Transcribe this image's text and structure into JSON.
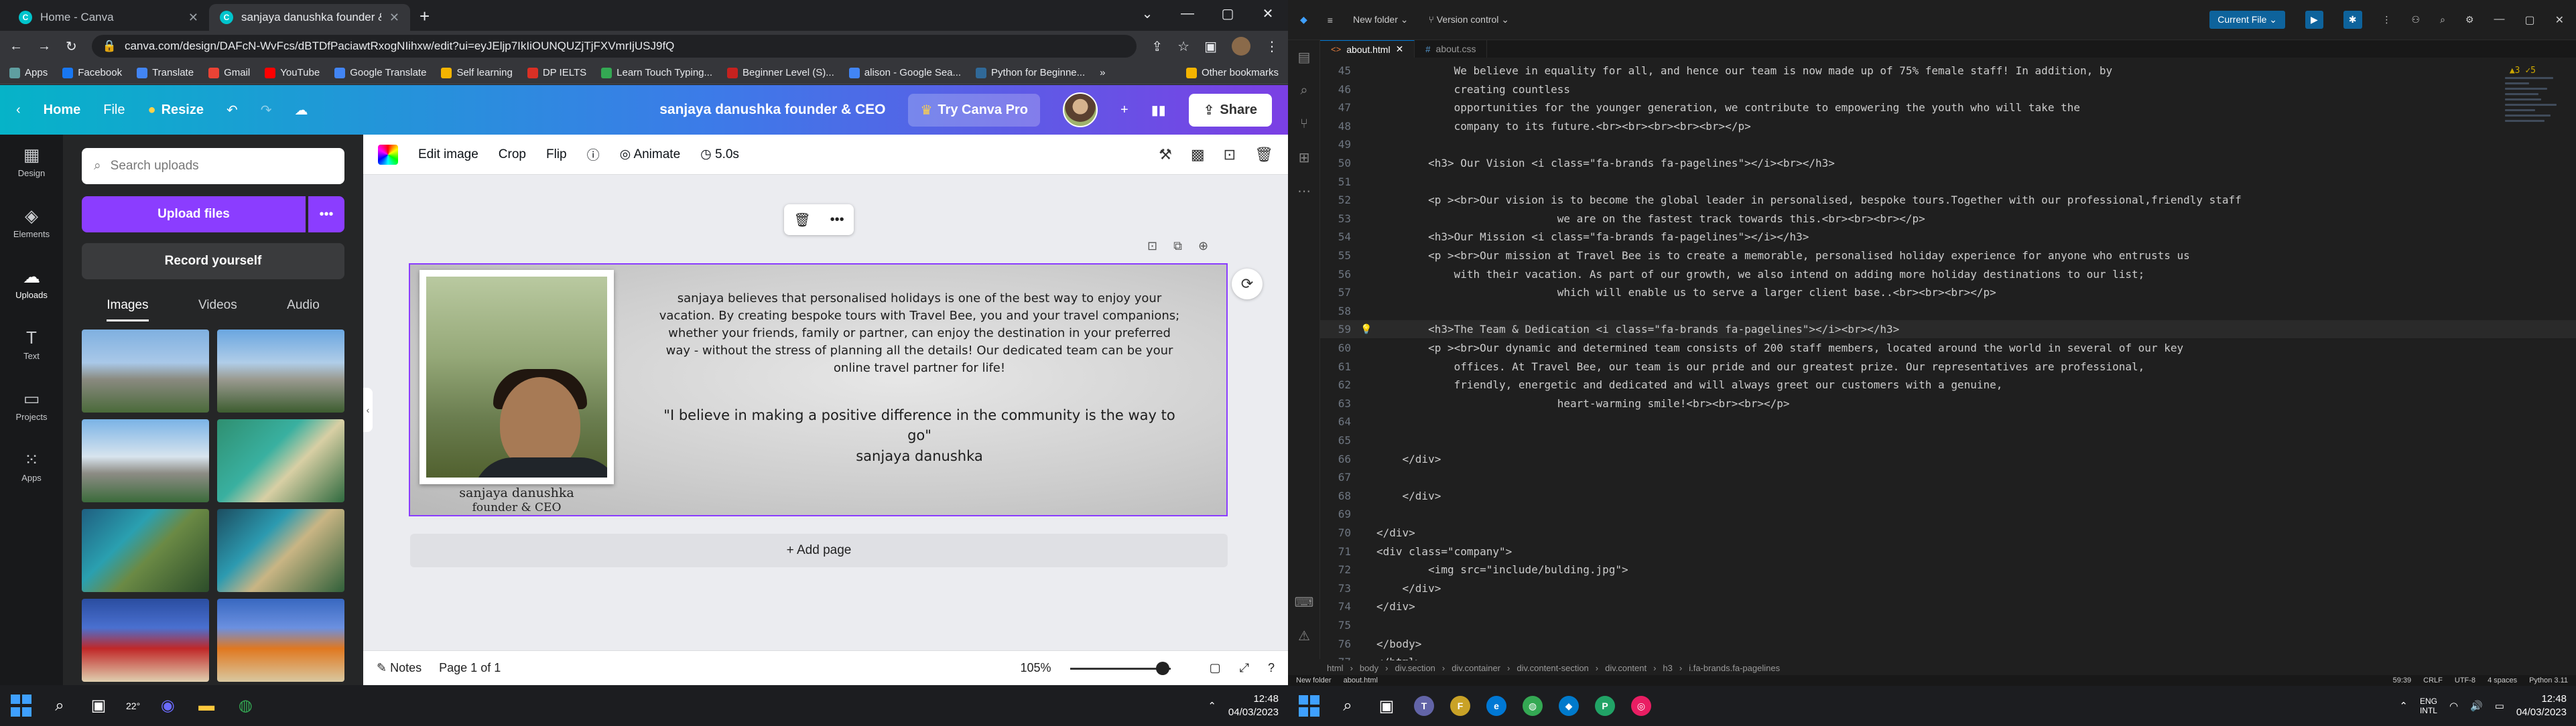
{
  "chrome": {
    "tabs": [
      {
        "title": "Home - Canva",
        "active": false
      },
      {
        "title": "sanjaya danushka founder & CEO",
        "active": true
      }
    ],
    "url": "canva.com/design/DAFcN-WvFcs/dBTDfPaciawtRxogNIihxw/edit?ui=eyJEljp7IkIiOUNQUZjTjFXVmrIjUSJ9fQ",
    "bookmarks": [
      "Apps",
      "Facebook",
      "Translate",
      "Gmail",
      "YouTube",
      "Google Translate",
      "Self learning",
      "DP IELTS",
      "Learn Touch Typing...",
      "Beginner Level (S)...",
      "alison - Google Sea...",
      "Python for Beginne..."
    ],
    "bookmarks_more": "»",
    "other_bookmarks": "Other bookmarks"
  },
  "canva": {
    "header": {
      "home": "Home",
      "file": "File",
      "resize": "Resize",
      "doc_title": "sanjaya danushka founder & CEO",
      "try_pro": "Try Canva Pro",
      "share": "Share"
    },
    "rail": [
      "Design",
      "Elements",
      "Uploads",
      "Text",
      "Projects",
      "Apps"
    ],
    "panel": {
      "search_placeholder": "Search uploads",
      "upload_files": "Upload files",
      "record": "Record yourself",
      "tabs": [
        "Images",
        "Videos",
        "Audio"
      ]
    },
    "toolbar": {
      "edit_image": "Edit image",
      "crop": "Crop",
      "flip": "Flip",
      "animate": "Animate",
      "duration": "5.0s"
    },
    "page": {
      "caption_name": "sanjaya danushka",
      "caption_role": "founder & CEO",
      "body": "sanjaya believes that personalised holidays is one of the best way to enjoy your vacation. By creating bespoke tours with Travel Bee, you and your travel companions; whether your friends, family or partner, can enjoy the destination in your preferred way - without the stress of planning all the details! Our dedicated team can be your online travel partner for life!",
      "quote": "\"I believe in making a positive difference in the community is the way to go\"",
      "signature": "sanjaya danushka"
    },
    "add_page": "+ Add page",
    "bottom": {
      "notes": "Notes",
      "page_info": "Page 1 of 1",
      "zoom": "105%",
      "zoom_value": 0.8
    }
  },
  "taskbar_left": {
    "weather_temp": "22°",
    "time": "12:48",
    "date": "04/03/2023"
  },
  "vscode": {
    "title": {
      "folder": "New folder",
      "vc": "Version control",
      "current_file": "Current File"
    },
    "tabs": [
      {
        "name": "about.html",
        "active": true
      },
      {
        "name": "about.css",
        "active": false
      }
    ],
    "warnings": "▲3 ✓5",
    "lines": [
      {
        "n": "45",
        "t": "            We believe in equality for all, and hence our team is now made up of 75% female staff! In addition, by"
      },
      {
        "n": "46",
        "t": "            creating countless"
      },
      {
        "n": "47",
        "t": "            opportunities for the younger generation, we contribute to empowering the youth who will take the"
      },
      {
        "n": "48",
        "t": "            company to its future.<br><br><br><br><br></p>"
      },
      {
        "n": "49",
        "t": ""
      },
      {
        "n": "50",
        "t": "        <h3> Our Vision <i class=\"fa-brands fa-pagelines\"></i><br></h3>"
      },
      {
        "n": "51",
        "t": ""
      },
      {
        "n": "52",
        "t": "        <p ><br>Our vision is to become the global leader in personalised, bespoke tours.Together with our professional,friendly staff"
      },
      {
        "n": "53",
        "t": "                            we are on the fastest track towards this.<br><br><br></p>"
      },
      {
        "n": "54",
        "t": "        <h3>Our Mission <i class=\"fa-brands fa-pagelines\"></i></h3>"
      },
      {
        "n": "55",
        "t": "        <p ><br>Our mission at Travel Bee is to create a memorable, personalised holiday experience for anyone who entrusts us"
      },
      {
        "n": "56",
        "t": "            with their vacation. As part of our growth, we also intend on adding more holiday destinations to our list;"
      },
      {
        "n": "57",
        "t": "                            which will enable us to serve a larger client base..<br><br><br></p>"
      },
      {
        "n": "58",
        "t": ""
      },
      {
        "n": "59",
        "t": "        <h3>The Team & Dedication <i class=\"fa-brands fa-pagelines\"></i><br></h3>"
      },
      {
        "n": "60",
        "t": "        <p ><br>Our dynamic and determined team consists of 200 staff members, located around the world in several of our key"
      },
      {
        "n": "61",
        "t": "            offices. At Travel Bee, our team is our pride and our greatest prize. Our representatives are professional,"
      },
      {
        "n": "62",
        "t": "            friendly, energetic and dedicated and will always greet our customers with a genuine,"
      },
      {
        "n": "63",
        "t": "                            heart-warming smile!<br><br><br></p>"
      },
      {
        "n": "64",
        "t": ""
      },
      {
        "n": "65",
        "t": ""
      },
      {
        "n": "66",
        "t": "    </div>"
      },
      {
        "n": "67",
        "t": ""
      },
      {
        "n": "68",
        "t": "    </div>"
      },
      {
        "n": "69",
        "t": ""
      },
      {
        "n": "70",
        "t": "</div>"
      },
      {
        "n": "71",
        "t": "<div class=\"company\">"
      },
      {
        "n": "72",
        "t": "        <img src=\"include/bulding.jpg\">"
      },
      {
        "n": "73",
        "t": "    </div>"
      },
      {
        "n": "74",
        "t": "</div>"
      },
      {
        "n": "75",
        "t": ""
      },
      {
        "n": "76",
        "t": "</body>"
      },
      {
        "n": "77",
        "t": "</html>"
      }
    ],
    "current_line": "59",
    "breadcrumb": [
      "html",
      "body",
      "div.section",
      "div.container",
      "div.content-section",
      "div.content",
      "h3",
      "i.fa-brands.fa-pagelines"
    ],
    "status_left": [
      "New folder",
      "about.html"
    ],
    "status_right": [
      "59:39",
      "CRLF",
      "UTF-8",
      "4 spaces",
      "Python 3.11"
    ],
    "tray_lang": "ENG",
    "tray_region": "INTL",
    "time": "12:48",
    "date": "04/03/2023"
  }
}
